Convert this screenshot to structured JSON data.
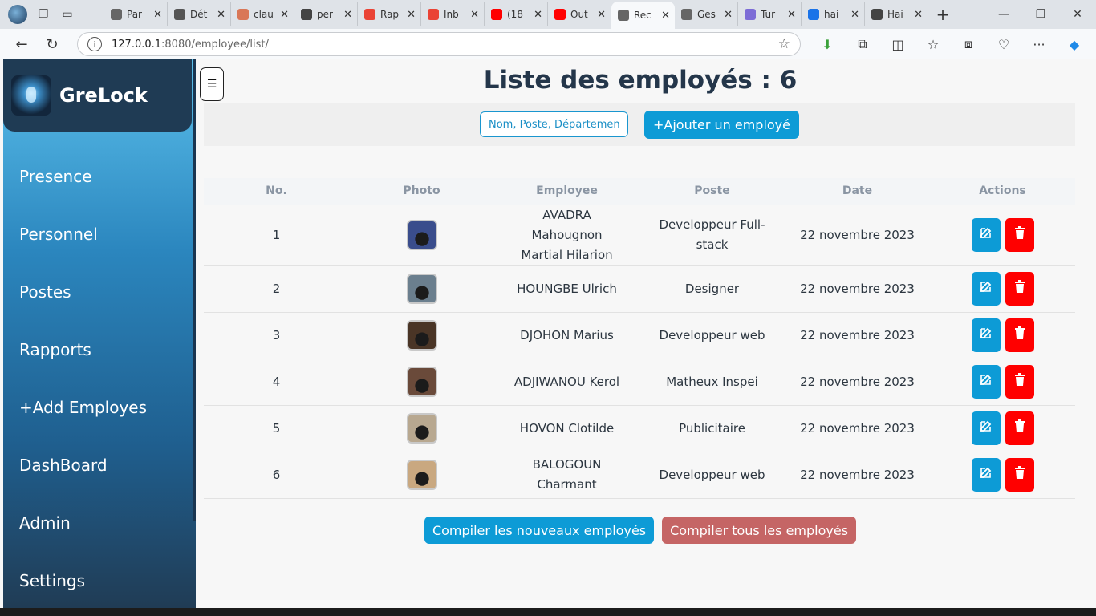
{
  "browser": {
    "tabs": [
      {
        "label": "Par",
        "icon": "gear-icon",
        "color": "#666666"
      },
      {
        "label": "Dét",
        "icon": "openai-icon",
        "color": "#555555"
      },
      {
        "label": "clau",
        "icon": "claude-icon",
        "color": "#d97757"
      },
      {
        "label": "per",
        "icon": "grid-icon",
        "color": "#444444"
      },
      {
        "label": "Rap",
        "icon": "gmail-icon",
        "color": "#ea4335"
      },
      {
        "label": "Inb",
        "icon": "gmail-icon",
        "color": "#ea4335"
      },
      {
        "label": "(18",
        "icon": "youtube-icon",
        "color": "#ff0000"
      },
      {
        "label": "Out",
        "icon": "youtube-icon",
        "color": "#ff0000"
      },
      {
        "label": "Rec",
        "icon": "page-icon",
        "color": "#666666",
        "active": true
      },
      {
        "label": "Ges",
        "icon": "page-icon",
        "color": "#666666"
      },
      {
        "label": "Tur",
        "icon": "brain-icon",
        "color": "#7c6cd6"
      },
      {
        "label": "hai",
        "icon": "search-icon",
        "color": "#1a73e8"
      },
      {
        "label": "Hai",
        "icon": "flower-icon",
        "color": "#444444"
      }
    ],
    "url_host": "127.0.0.1",
    "url_path": ":8080/employee/list/"
  },
  "sidebar": {
    "brand": "GreLock",
    "items": [
      "Presence",
      "Personnel",
      "Postes",
      "Rapports",
      "+Add Employes",
      "DashBoard",
      "Admin",
      "Settings"
    ]
  },
  "main": {
    "title": "Liste des employés : 6",
    "search_placeholder": "Nom, Poste, Département",
    "add_button": "+Ajouter un employé",
    "columns": [
      "No.",
      "Photo",
      "Employee",
      "Poste",
      "Date",
      "Actions"
    ],
    "rows": [
      {
        "no": "1",
        "employee": "AVADRA Mahougnon Martial Hilarion",
        "poste": "Developpeur Full-stack",
        "date": "22 novembre 2023",
        "photo_color": "#3a4d8c"
      },
      {
        "no": "2",
        "employee": "HOUNGBE Ulrich",
        "poste": "Designer",
        "date": "22 novembre 2023",
        "photo_color": "#6b7f8e"
      },
      {
        "no": "3",
        "employee": "DJOHON Marius",
        "poste": "Developpeur web",
        "date": "22 novembre 2023",
        "photo_color": "#4a3526"
      },
      {
        "no": "4",
        "employee": "ADJIWANOU Kerol",
        "poste": "Matheux Inspei",
        "date": "22 novembre 2023",
        "photo_color": "#6a4a3a"
      },
      {
        "no": "5",
        "employee": "HOVON Clotilde",
        "poste": "Publicitaire",
        "date": "22 novembre 2023",
        "photo_color": "#b8a890"
      },
      {
        "no": "6",
        "employee": "BALOGOUN Charmant",
        "poste": "Developpeur web",
        "date": "22 novembre 2023",
        "photo_color": "#c9a880"
      }
    ],
    "compile_new": "Compiler les nouveaux employés",
    "compile_all": "Compiler tous les employés"
  }
}
